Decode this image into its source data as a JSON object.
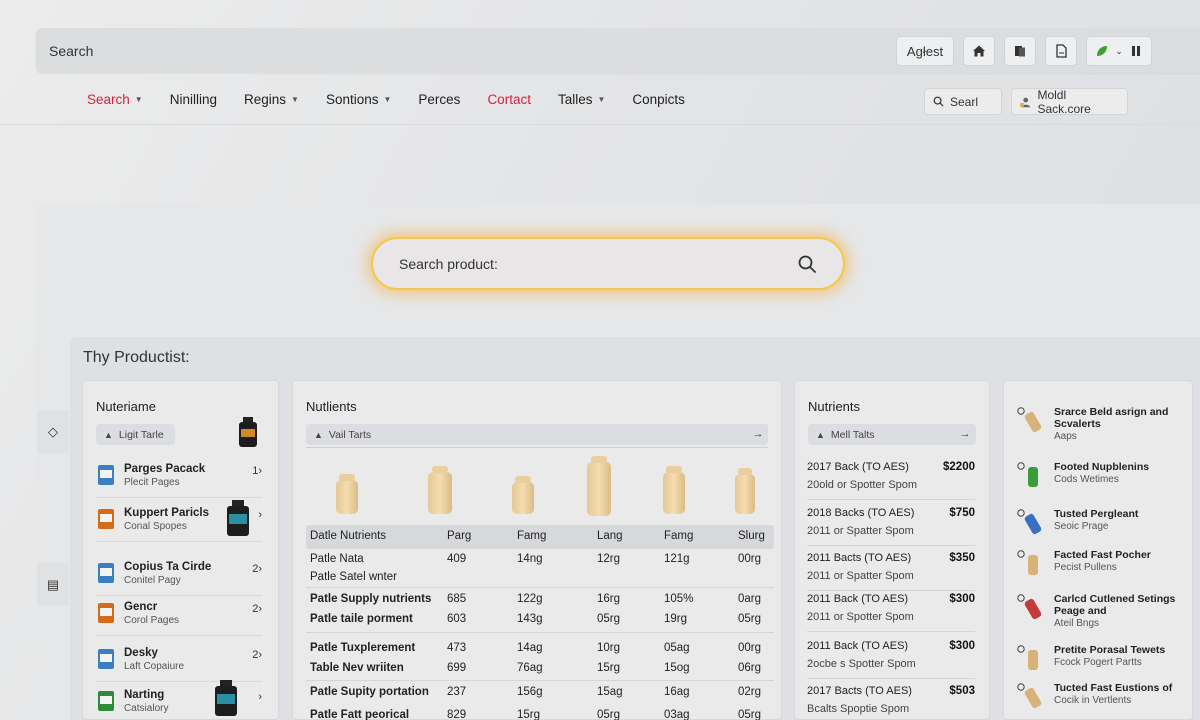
{
  "topbar": {
    "search_label": "Search",
    "agent_label": "Agłest",
    "home_icon": "home-icon",
    "docs_icon": "documents-icon",
    "file_icon": "file-icon"
  },
  "nav": {
    "items": [
      {
        "label": "Search",
        "caret": true,
        "active": true
      },
      {
        "label": "Ninilling",
        "caret": false,
        "active": false
      },
      {
        "label": "Regins",
        "caret": true,
        "active": false
      },
      {
        "label": "Sontions",
        "caret": true,
        "active": false
      },
      {
        "label": "Perces",
        "caret": false,
        "active": false
      },
      {
        "label": "Cortact",
        "caret": false,
        "active": true
      },
      {
        "label": "Talles",
        "caret": true,
        "active": false
      },
      {
        "label": "Conpicts",
        "caret": false,
        "active": false
      }
    ],
    "search_placeholder": "Searl",
    "user_label": "Moldl Sack.core"
  },
  "main": {
    "search_placeholder": "Search product:",
    "products_title": "Thy Productist:"
  },
  "card1": {
    "title": "Nuteriame",
    "pill": "Ligit Tarle",
    "items": [
      {
        "name": "Parges Pacack",
        "sub": "Plecit Pages",
        "chev": "1›"
      },
      {
        "name": "Kuppert Paricls",
        "sub": "Conal Spopes",
        "chev": "›"
      },
      {
        "name": "Copius Ta Cirde",
        "sub": "Conitel Pagy",
        "chev": "2›"
      },
      {
        "name": "Gencr",
        "sub": "Corol Pages",
        "chev": "2›"
      },
      {
        "name": "Desky",
        "sub": "Laft Copaiure",
        "chev": "2›"
      },
      {
        "name": "Narting",
        "sub": "Catsialory",
        "chev": "›"
      }
    ]
  },
  "card2": {
    "title": "Nutlients",
    "pill": "Vail Tarts",
    "headers": [
      "Datle Nutrients",
      "Parg",
      "Famg",
      "Lang",
      "Famg",
      "Slurg"
    ],
    "rows": [
      [
        "Patle Nata",
        "409",
        "14ng",
        "12rg",
        "121g",
        "00rg"
      ],
      [
        "Patle Satel wnter",
        "",
        "",
        "",
        "",
        ""
      ],
      [
        "Patle Supply nutrients",
        "685",
        "122g",
        "16rg",
        "105%",
        "0arg"
      ],
      [
        "Patle taile porment",
        "603",
        "143g",
        "05rg",
        "19rg",
        "05rg"
      ],
      [
        "Patle Tuxplerement",
        "473",
        "14ag",
        "10rg",
        "05ag",
        "00rg"
      ],
      [
        "Table Nev wriiten",
        "699",
        "76ag",
        "15rg",
        "15og",
        "06rg"
      ],
      [
        "Patle Supity portation",
        "237",
        "156g",
        "15ag",
        "16ag",
        "02rg"
      ],
      [
        "Patle Fatt peorical",
        "829",
        "15rg",
        "05rg",
        "03ag",
        "05rg"
      ]
    ]
  },
  "card3": {
    "title": "Nutrients",
    "pill": "Mell Talts",
    "rows": [
      {
        "l1": "2017 Back (TO AES)",
        "l2": "20old or Spotter Spom",
        "price": "$2200"
      },
      {
        "l1": "2018 Backs (TO AES)",
        "l2": "2011 or Spatter Spom",
        "price": "$750"
      },
      {
        "l1": "2011 Bacts (TO AES)",
        "l2": "2011 or Spatter Spom",
        "price": "$350"
      },
      {
        "l1": "2011 Back (TO AES)",
        "l2": "2011 or Spotter Spom",
        "price": "$300"
      },
      {
        "l1": "2011 Back (TO AES)",
        "l2": "2ocbe s Spotter Spom",
        "price": "$300"
      },
      {
        "l1": "2017 Bacts (TO AES)",
        "l2": "Bcalts Spoptie Spom",
        "price": "$503"
      }
    ]
  },
  "card4": {
    "items": [
      {
        "t1": "Srarce Beld asrign and Scvalerts",
        "t2": "Aaps"
      },
      {
        "t1": "Footed Nupblenins",
        "t2": "Cods Wetimes"
      },
      {
        "t1": "Tusted Pergleant",
        "t2": "Seoic Prage"
      },
      {
        "t1": "Facted Fast Pocher",
        "t2": "Pecist Pullens"
      },
      {
        "t1": "Carlcd Cutlened Setings Peage and",
        "t2": "Ateil Bngs"
      },
      {
        "t1": "Pretite Porasal Tewets",
        "t2": "Fcock Pogert Partts"
      },
      {
        "t1": "Tucted Fast Eustions of",
        "t2": "Cocik in Vertlents"
      }
    ]
  },
  "colors": {
    "accent_red": "#d6203b",
    "search_glow": "#f3c94a"
  }
}
